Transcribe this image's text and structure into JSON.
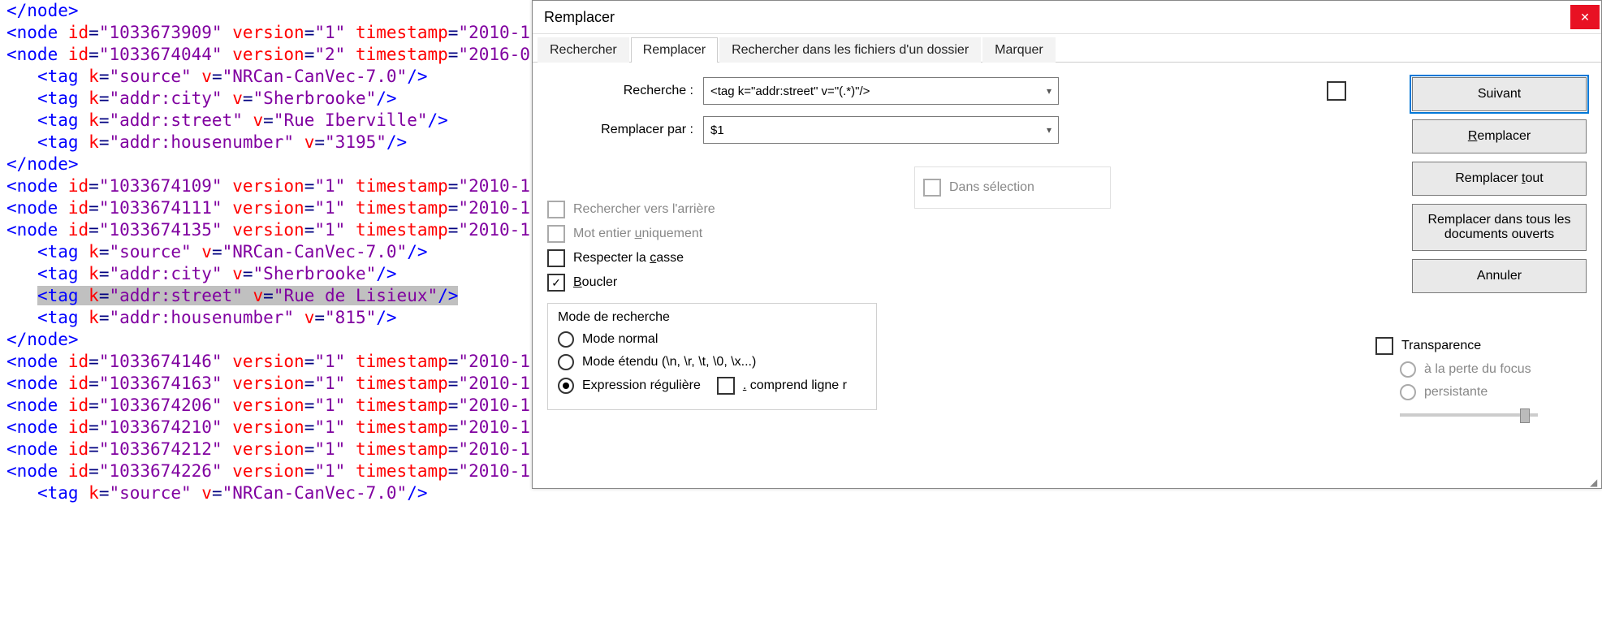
{
  "dialog": {
    "title": "Remplacer",
    "tabs": [
      "Rechercher",
      "Remplacer",
      "Rechercher dans les fichiers d'un dossier",
      "Marquer"
    ],
    "active_tab": 1,
    "search_label": "Recherche :",
    "search_value": "<tag k=\"addr:street\" v=\"(.*)\"/>",
    "replace_label": "Remplacer par :",
    "replace_value": "$1",
    "in_selection": "Dans sélection",
    "buttons": {
      "next": "Suivant",
      "replace": "Remplacer",
      "replace_all": "Remplacer tout",
      "replace_all_docs": "Remplacer dans tous les documents ouverts",
      "cancel": "Annuler"
    },
    "opts": {
      "backward": "Rechercher vers l'arrière",
      "whole_word": "Mot entier uniquement",
      "match_case": "Respecter la casse",
      "wrap": "Boucler",
      "wrap_checked": true
    },
    "mode": {
      "title": "Mode de recherche",
      "normal": "Mode normal",
      "extended": "Mode étendu (\\n, \\r, \\t, \\0, \\x...)",
      "regex": "Expression régulière",
      "dot_nl": ". comprend ligne r",
      "selected": "regex"
    },
    "transparency": {
      "label": "Transparence",
      "on_lose_focus": "à la perte du focus",
      "persistent": "persistante"
    }
  },
  "editor": {
    "lines": [
      {
        "t": "close",
        "txt": "</node>"
      },
      {
        "t": "node",
        "id": "1033673909",
        "ver": "1",
        "ts": "2010-1"
      },
      {
        "t": "node",
        "id": "1033674044",
        "ver": "2",
        "ts": "2016-0"
      },
      {
        "t": "tag",
        "k": "source",
        "v": "NRCan-CanVec-7.0"
      },
      {
        "t": "tag",
        "k": "addr:city",
        "v": "Sherbrooke"
      },
      {
        "t": "tag",
        "k": "addr:street",
        "v": "Rue Iberville"
      },
      {
        "t": "tag",
        "k": "addr:housenumber",
        "v": "3195"
      },
      {
        "t": "close",
        "txt": "</node>"
      },
      {
        "t": "node",
        "id": "1033674109",
        "ver": "1",
        "ts": "2010-1"
      },
      {
        "t": "node",
        "id": "1033674111",
        "ver": "1",
        "ts": "2010-1"
      },
      {
        "t": "node",
        "id": "1033674135",
        "ver": "1",
        "ts": "2010-1"
      },
      {
        "t": "tag",
        "k": "source",
        "v": "NRCan-CanVec-7.0"
      },
      {
        "t": "tag",
        "k": "addr:city",
        "v": "Sherbrooke"
      },
      {
        "t": "tag",
        "k": "addr:street",
        "v": "Rue de Lisieux",
        "sel": true
      },
      {
        "t": "tag",
        "k": "addr:housenumber",
        "v": "815"
      },
      {
        "t": "close",
        "txt": "</node>"
      },
      {
        "t": "node",
        "id": "1033674146",
        "ver": "1",
        "ts": "2010-1"
      },
      {
        "t": "node",
        "id": "1033674163",
        "ver": "1",
        "ts": "2010-1"
      },
      {
        "t": "node",
        "id": "1033674206",
        "ver": "1",
        "ts": "2010-1"
      },
      {
        "t": "node",
        "id": "1033674210",
        "ver": "1",
        "ts": "2010-1"
      },
      {
        "t": "node",
        "id": "1033674212",
        "ver": "1",
        "ts": "2010-1"
      },
      {
        "t": "node",
        "id": "1033674226",
        "ver": "1",
        "ts": "2010-1"
      },
      {
        "t": "tag",
        "k": "source",
        "v": "NRCan-CanVec-7.0"
      }
    ]
  }
}
